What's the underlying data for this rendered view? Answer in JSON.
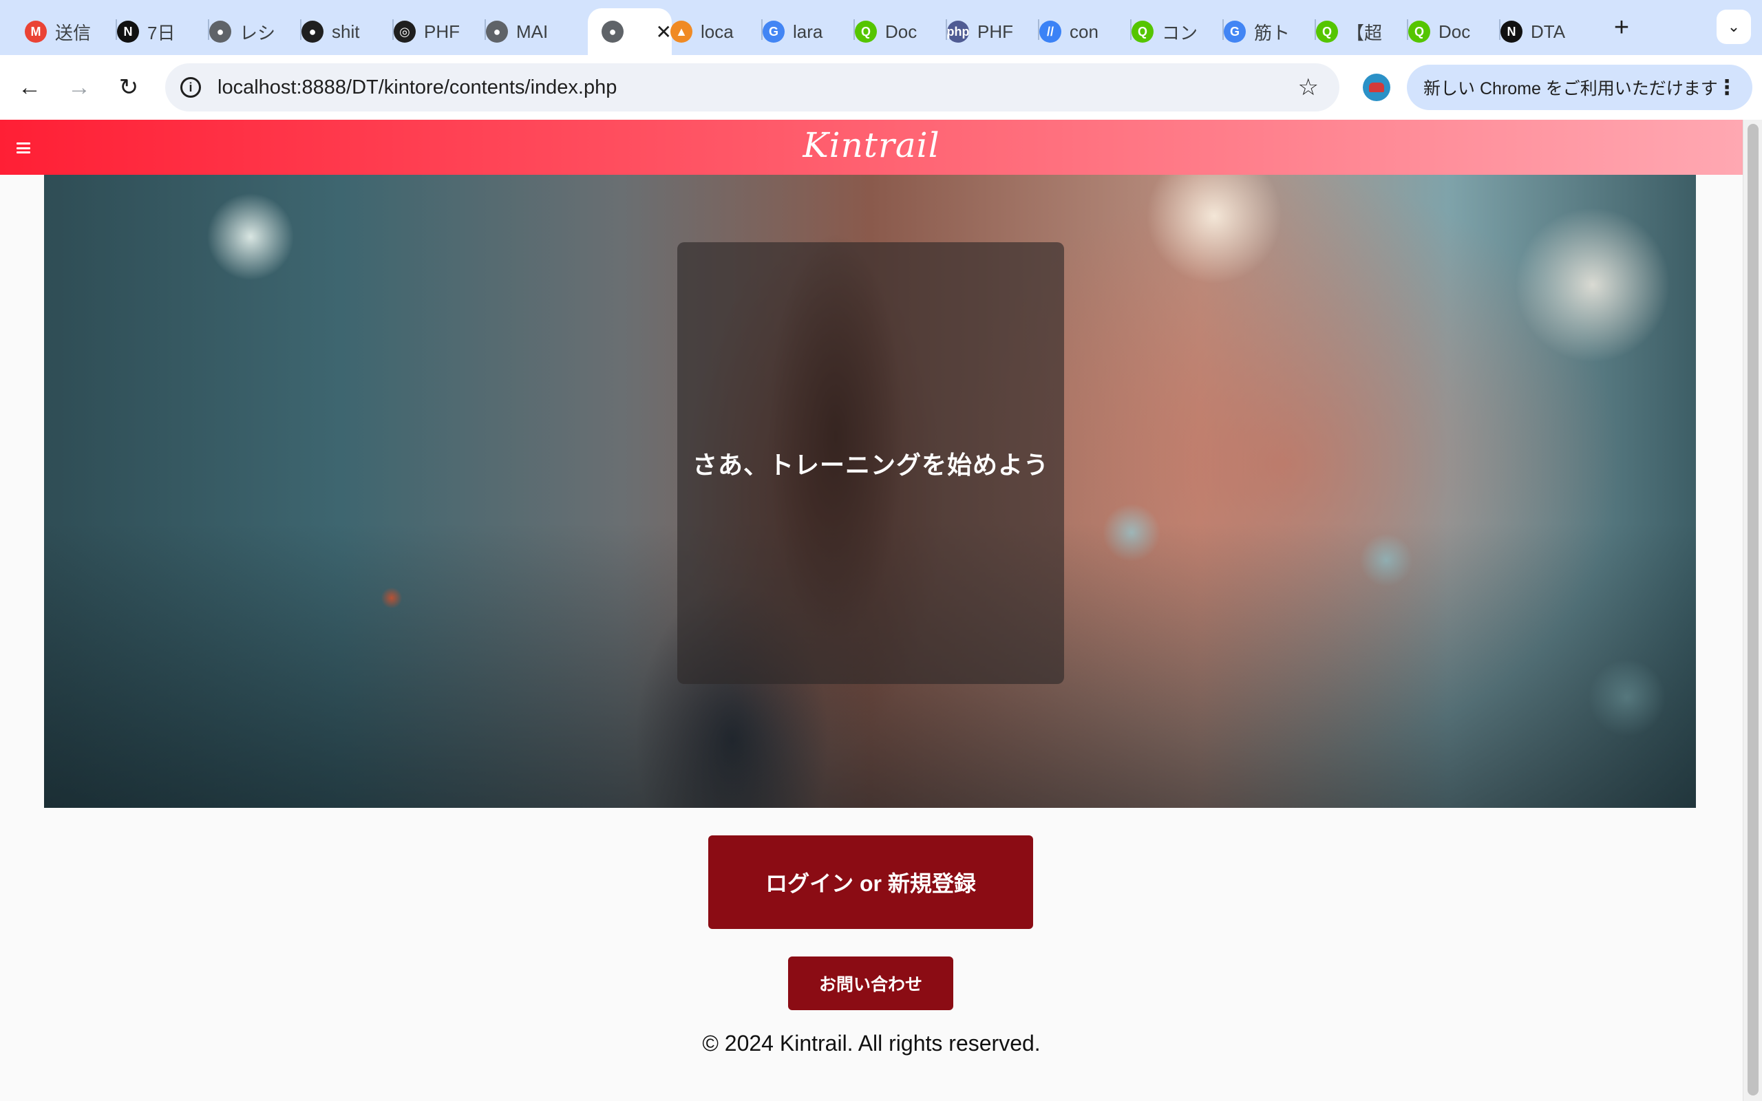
{
  "browser": {
    "tabs": [
      {
        "title": "送信",
        "icon": "gmail-icon",
        "color": "#ea4335",
        "glyph": "M"
      },
      {
        "title": "7日",
        "icon": "notion-icon",
        "color": "#111111",
        "glyph": "N"
      },
      {
        "title": "レシ",
        "icon": "globe-icon",
        "color": "#5f6368",
        "glyph": "●"
      },
      {
        "title": "shit",
        "icon": "github-icon",
        "color": "#1f1f1f",
        "glyph": "●"
      },
      {
        "title": "PHF",
        "icon": "openai-icon",
        "color": "#1f1f1f",
        "glyph": "◎"
      },
      {
        "title": "MAI",
        "icon": "mamp-icon",
        "color": "#5f6368",
        "glyph": "●"
      },
      {
        "title": "",
        "icon": "mamp-icon",
        "color": "#5f6368",
        "glyph": "●",
        "active": true
      },
      {
        "title": "loca",
        "icon": "phpmyadmin-icon",
        "color": "#f08a24",
        "glyph": "▲"
      },
      {
        "title": "lara",
        "icon": "google-icon",
        "color": "#4285f4",
        "glyph": "G"
      },
      {
        "title": "Doc",
        "icon": "qiita-icon",
        "color": "#55c500",
        "glyph": "Q"
      },
      {
        "title": "PHF",
        "icon": "php-icon",
        "color": "#4f5b93",
        "glyph": "php"
      },
      {
        "title": "con",
        "icon": "slash-icon",
        "color": "#3b82f6",
        "glyph": "//"
      },
      {
        "title": "コン",
        "icon": "qiita-icon",
        "color": "#55c500",
        "glyph": "Q"
      },
      {
        "title": "筋ト",
        "icon": "google-icon",
        "color": "#4285f4",
        "glyph": "G"
      },
      {
        "title": "【超",
        "icon": "qiita-icon",
        "color": "#55c500",
        "glyph": "Q"
      },
      {
        "title": "Doc",
        "icon": "qiita-icon",
        "color": "#55c500",
        "glyph": "Q"
      },
      {
        "title": "DTA",
        "icon": "notion-icon",
        "color": "#111111",
        "glyph": "N"
      }
    ],
    "active_close": "✕",
    "new_tab": "+",
    "tab_menu": "⌄",
    "back": "←",
    "forward": "→",
    "reload": "↻",
    "info": "i",
    "url": "localhost:8888/DT/kintore/contents/index.php",
    "star": "☆",
    "update_label": "新しい Chrome をご利用いただけます",
    "update_dots": "⋮"
  },
  "site": {
    "brand": "Kintrail",
    "hero_text": "さあ、トレーニングを始めよう",
    "login_button": "ログイン or 新規登録",
    "contact_button": "お問い合わせ",
    "footer": "© 2024 Kintrail. All rights reserved.",
    "colors": {
      "header_start": "#ff1f35",
      "header_end": "#ffa8b2",
      "button": "#8b0c14"
    }
  }
}
